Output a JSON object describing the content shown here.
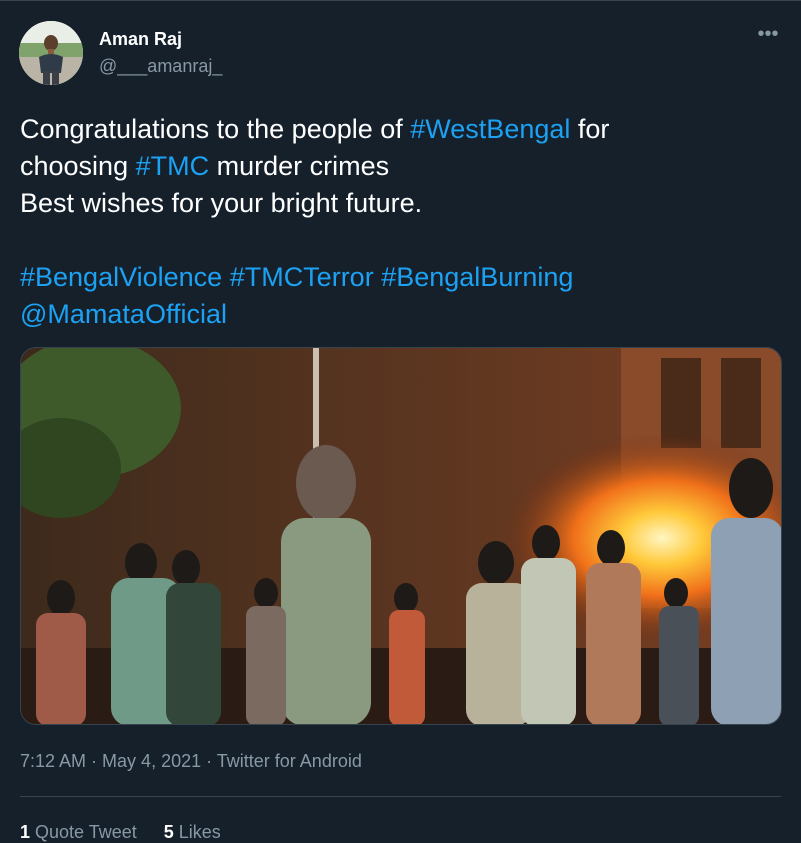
{
  "user": {
    "display_name": "Aman Raj",
    "handle": "@___amanraj_"
  },
  "more_icon": "more-horizontal-icon",
  "tweet": {
    "line1": {
      "pre": "Congratulations to the people of ",
      "hashtag": "#WestBengal",
      "post": " for"
    },
    "line2": {
      "pre": "choosing ",
      "hashtag": "#TMC",
      "post": " murder crimes"
    },
    "line3": "Best wishes for your bright future.",
    "hashtags": [
      "#BengalViolence",
      "#TMCTerror",
      "#BengalBurning"
    ],
    "mention": "@MamataOfficial"
  },
  "meta": {
    "time": "7:12 AM",
    "sep1": " · ",
    "date": "May 4, 2021",
    "sep2": " · ",
    "source": "Twitter for Android"
  },
  "stats": {
    "quote_count": "1",
    "quote_label": "Quote Tweet",
    "like_count": "5",
    "like_label": "Likes"
  },
  "colors": {
    "background": "#15202b",
    "link": "#1da1f2",
    "secondary_text": "#8899a6",
    "border": "#38444d"
  }
}
